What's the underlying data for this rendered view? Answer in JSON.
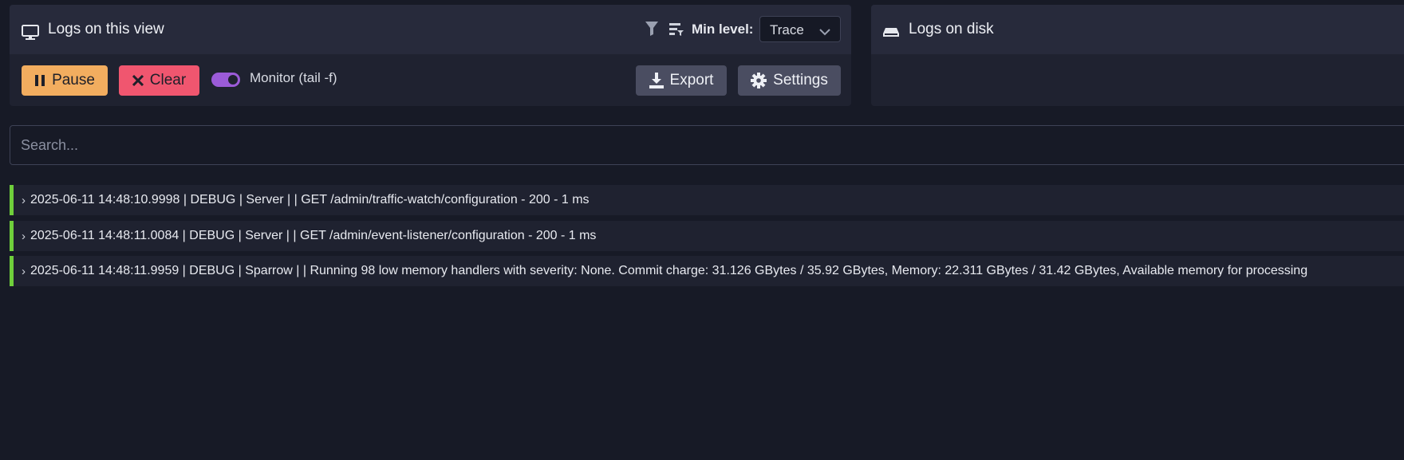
{
  "view_panel": {
    "title": "Logs on this view",
    "icons": {
      "title": "monitor-icon",
      "filter": "filter-icon",
      "level": "level-filter-icon"
    },
    "min_level_label": "Min level:",
    "min_level_value": "Trace",
    "pause_label": "Pause",
    "clear_label": "Clear",
    "monitor_label": "Monitor (tail -f)",
    "monitor_on": true,
    "export_label": "Export",
    "settings_label": "Settings"
  },
  "disk_panel": {
    "title": "Logs on disk",
    "icon": "disk-icon"
  },
  "search": {
    "placeholder": "Search..."
  },
  "logs": [
    {
      "text": "2025-06-11 14:48:10.9998 | DEBUG | Server | | GET /admin/traffic-watch/configuration - 200 - 1 ms"
    },
    {
      "text": "2025-06-11 14:48:11.0084 | DEBUG | Server | | GET /admin/event-listener/configuration - 200 - 1 ms"
    },
    {
      "text": "2025-06-11 14:48:11.9959 | DEBUG | Sparrow | | Running 98 low memory handlers with severity: None. Commit charge: 31.126 GBytes / 35.92 GBytes, Memory: 22.311 GBytes / 31.42 GBytes, Available memory for processing"
    }
  ],
  "colors": {
    "pause": "#f2ad5f",
    "clear": "#f0566f",
    "toggle": "#9b5bd8",
    "debug_bar": "#6fcf3b"
  }
}
